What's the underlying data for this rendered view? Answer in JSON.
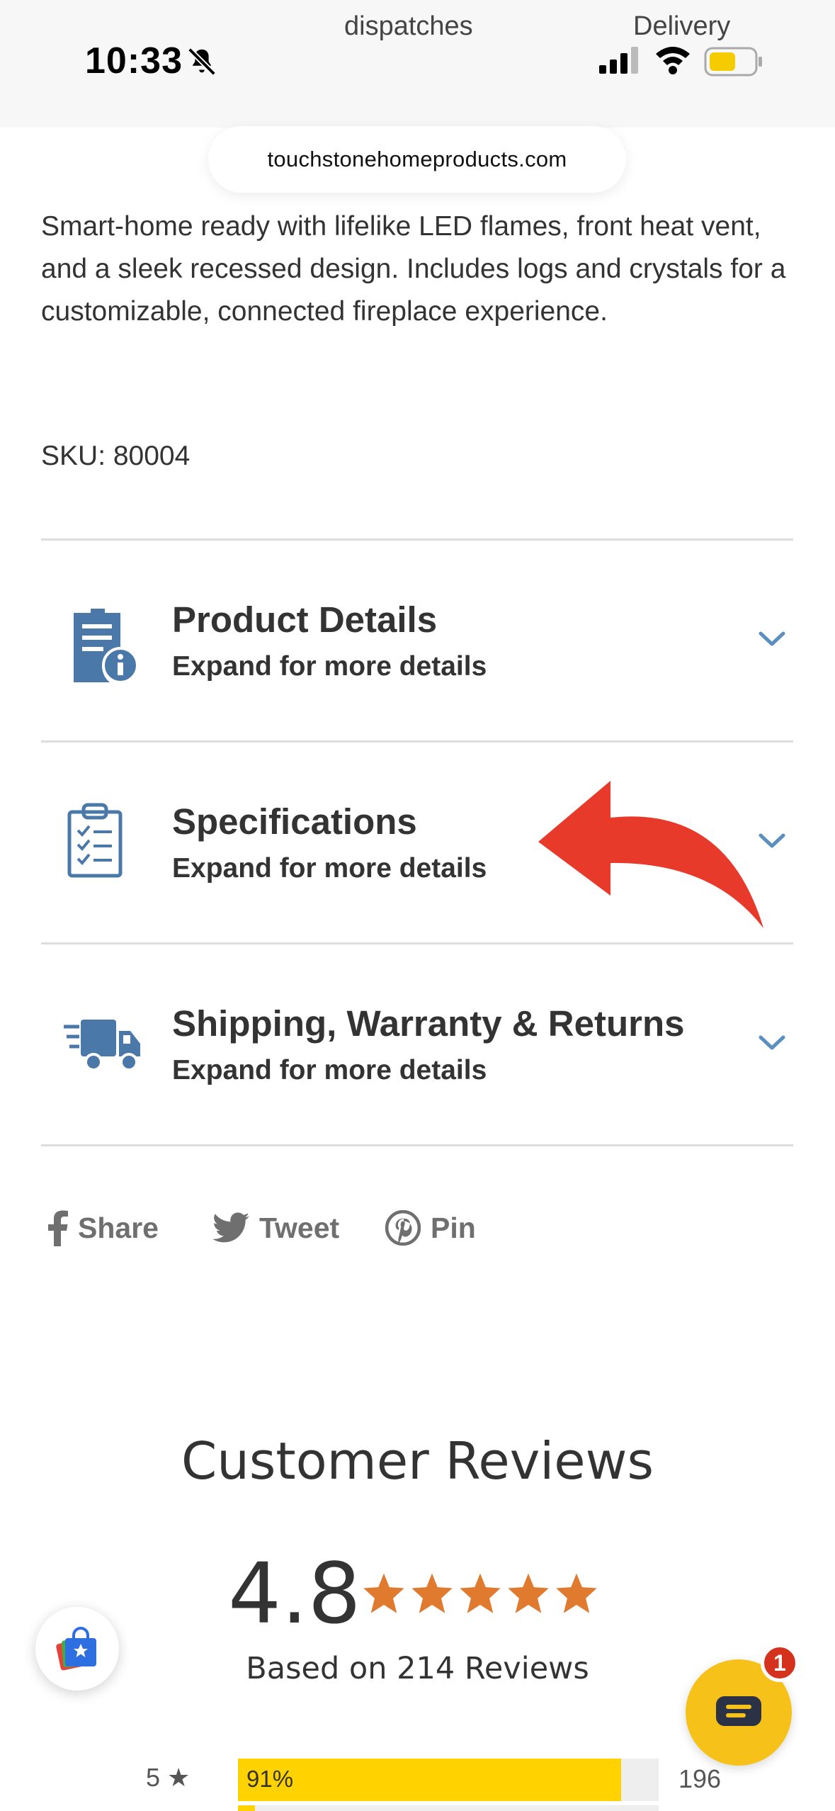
{
  "status_bar": {
    "peek_left": "dispatches",
    "peek_right": "Delivery",
    "time": "10:33"
  },
  "browser": {
    "url": "touchstonehomeproducts.com"
  },
  "product": {
    "description": "Smart-home ready with lifelike LED flames, front heat vent, and a sleek recessed design. Includes logs and crystals for a customizable, connected fireplace experience.",
    "sku": "SKU: 80004"
  },
  "accordion": [
    {
      "title": "Product Details",
      "subtitle": "Expand for more details",
      "icon": "document-info-icon"
    },
    {
      "title": "Specifications",
      "subtitle": "Expand for more details",
      "icon": "clipboard-checklist-icon"
    },
    {
      "title": "Shipping, Warranty & Returns",
      "subtitle": "Expand for more details",
      "icon": "delivery-truck-icon"
    }
  ],
  "social": {
    "share": "Share",
    "tweet": "Tweet",
    "pin": "Pin"
  },
  "reviews": {
    "title": "Customer Reviews",
    "average": "4.8",
    "based_on": "Based on 214 Reviews",
    "breakdown": [
      {
        "label": "5 ★",
        "percent_label": "91%",
        "fraction": 0.91,
        "count": "196"
      }
    ]
  },
  "chat_badge": "1",
  "colors": {
    "accent_blue": "#4a78a8",
    "star_orange": "#e07a2f",
    "bar_yellow": "#ffd200",
    "arrow_red": "#e83a2a",
    "chat_yellow": "#f6c21a"
  }
}
